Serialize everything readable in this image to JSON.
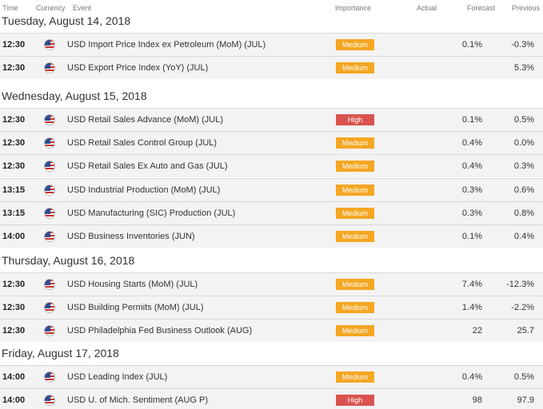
{
  "header": {
    "time": "Time",
    "currency": "Currency",
    "event": "Event",
    "importance": "Importance",
    "actual": "Actual",
    "forecast": "Forecast",
    "previous": "Previous"
  },
  "colors": {
    "medium": "#f5a623",
    "high": "#d9534f"
  },
  "days": [
    {
      "label": "Tuesday, August 14, 2018",
      "events": [
        {
          "time": "12:30",
          "currency_icon": "us-flag-icon",
          "event": "USD Import Price Index ex Petroleum (MoM) (JUL)",
          "importance": "Medium",
          "actual": "",
          "forecast": "0.1%",
          "previous": "-0.3%"
        },
        {
          "time": "12:30",
          "currency_icon": "us-flag-icon",
          "event": "USD Export Price Index (YoY) (JUL)",
          "importance": "Medium",
          "actual": "",
          "forecast": "",
          "previous": "5.3%"
        }
      ]
    },
    {
      "label": "Wednesday, August 15, 2018",
      "events": [
        {
          "time": "12:30",
          "currency_icon": "us-flag-icon",
          "event": "USD Retail Sales Advance (MoM) (JUL)",
          "importance": "High",
          "actual": "",
          "forecast": "0.1%",
          "previous": "0.5%"
        },
        {
          "time": "12:30",
          "currency_icon": "us-flag-icon",
          "event": "USD Retail Sales Control Group (JUL)",
          "importance": "Medium",
          "actual": "",
          "forecast": "0.4%",
          "previous": "0.0%"
        },
        {
          "time": "12:30",
          "currency_icon": "us-flag-icon",
          "event": "USD Retail Sales Ex Auto and Gas (JUL)",
          "importance": "Medium",
          "actual": "",
          "forecast": "0.4%",
          "previous": "0.3%"
        },
        {
          "time": "13:15",
          "currency_icon": "us-flag-icon",
          "event": "USD Industrial Production (MoM) (JUL)",
          "importance": "Medium",
          "actual": "",
          "forecast": "0.3%",
          "previous": "0.6%"
        },
        {
          "time": "13:15",
          "currency_icon": "us-flag-icon",
          "event": "USD Manufacturing (SIC) Production (JUL)",
          "importance": "Medium",
          "actual": "",
          "forecast": "0.3%",
          "previous": "0.8%"
        },
        {
          "time": "14:00",
          "currency_icon": "us-flag-icon",
          "event": "USD Business Inventories (JUN)",
          "importance": "Medium",
          "actual": "",
          "forecast": "0.1%",
          "previous": "0.4%"
        }
      ]
    },
    {
      "label": "Thursday, August 16, 2018",
      "events": [
        {
          "time": "12:30",
          "currency_icon": "us-flag-icon",
          "event": "USD Housing Starts (MoM) (JUL)",
          "importance": "Medium",
          "actual": "",
          "forecast": "7.4%",
          "previous": "-12.3%"
        },
        {
          "time": "12:30",
          "currency_icon": "us-flag-icon",
          "event": "USD Building Permits (MoM) (JUL)",
          "importance": "Medium",
          "actual": "",
          "forecast": "1.4%",
          "previous": "-2.2%"
        },
        {
          "time": "12:30",
          "currency_icon": "us-flag-icon",
          "event": "USD Philadelphia Fed Business Outlook (AUG)",
          "importance": "Medium",
          "actual": "",
          "forecast": "22",
          "previous": "25.7"
        }
      ]
    },
    {
      "label": "Friday, August 17, 2018",
      "events": [
        {
          "time": "14:00",
          "currency_icon": "us-flag-icon",
          "event": "USD Leading Index (JUL)",
          "importance": "Medium",
          "actual": "",
          "forecast": "0.4%",
          "previous": "0.5%"
        },
        {
          "time": "14:00",
          "currency_icon": "us-flag-icon",
          "event": "USD U. of Mich. Sentiment (AUG P)",
          "importance": "High",
          "actual": "",
          "forecast": "98",
          "previous": "97.9"
        }
      ]
    }
  ]
}
